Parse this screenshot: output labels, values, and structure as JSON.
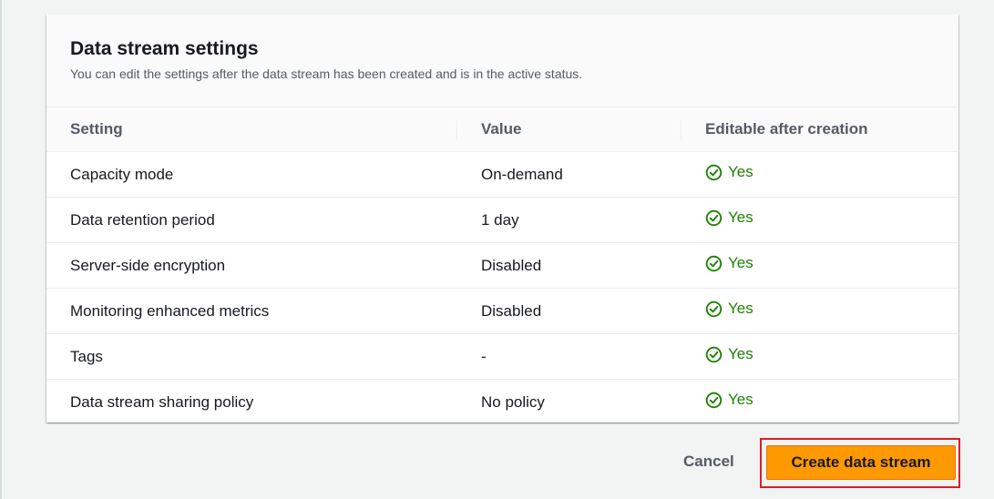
{
  "panel": {
    "title": "Data stream settings",
    "description": "You can edit the settings after the data stream has been created and is in the active status."
  },
  "table": {
    "headers": [
      "Setting",
      "Value",
      "Editable after creation"
    ],
    "rows": [
      {
        "setting": "Capacity mode",
        "value": "On-demand",
        "editable": "Yes"
      },
      {
        "setting": "Data retention period",
        "value": "1 day",
        "editable": "Yes"
      },
      {
        "setting": "Server-side encryption",
        "value": "Disabled",
        "editable": "Yes"
      },
      {
        "setting": "Monitoring enhanced metrics",
        "value": "Disabled",
        "editable": "Yes"
      },
      {
        "setting": "Tags",
        "value": "-",
        "editable": "Yes"
      },
      {
        "setting": "Data stream sharing policy",
        "value": "No policy",
        "editable": "Yes"
      }
    ]
  },
  "actions": {
    "cancel_label": "Cancel",
    "create_label": "Create data stream"
  },
  "icons": {
    "status": "status-positive-icon"
  },
  "colors": {
    "success": "#1d8102",
    "primary_button": "#ff9900",
    "highlight_border": "#d91f26"
  }
}
